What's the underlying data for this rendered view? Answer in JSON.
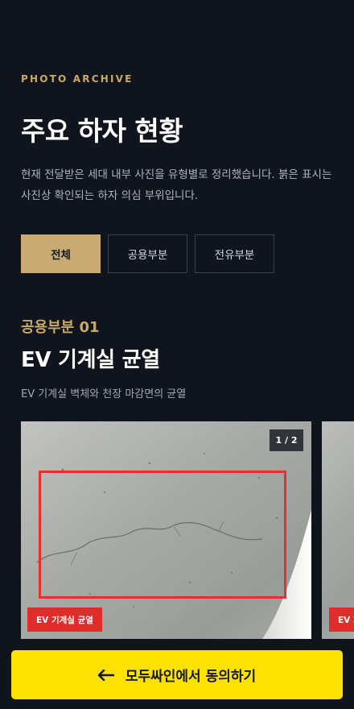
{
  "header": {
    "eyebrow": "PHOTO ARCHIVE",
    "title": "주요 하자 현황",
    "description": "현재 전달받은 세대 내부 사진을 유형별로 정리했습니다. 붉은 표시는 사진상 확인되는 하자 의심 부위입니다."
  },
  "filters": [
    {
      "label": "전체",
      "active": true
    },
    {
      "label": "공용부분",
      "active": false
    },
    {
      "label": "전유부분",
      "active": false
    }
  ],
  "section": {
    "number": "공용부분 01",
    "title": "EV 기계실 균열",
    "description": "EV 기계실 벽체와 천장 마감면의 균열"
  },
  "gallery": {
    "counter": "1 / 2",
    "cards": [
      {
        "tag": "EV 기계실 균열",
        "icon": "concrete-crack-photo"
      },
      {
        "tag": "EV 기",
        "icon": "photo-partial"
      }
    ]
  },
  "cta": {
    "label": "모두싸인에서 동의하기",
    "icon": "arrow-left-icon"
  },
  "colors": {
    "background": "#10141c",
    "accent": "#c9a96a",
    "highlight": "#e3322b",
    "cta": "#fde100"
  }
}
